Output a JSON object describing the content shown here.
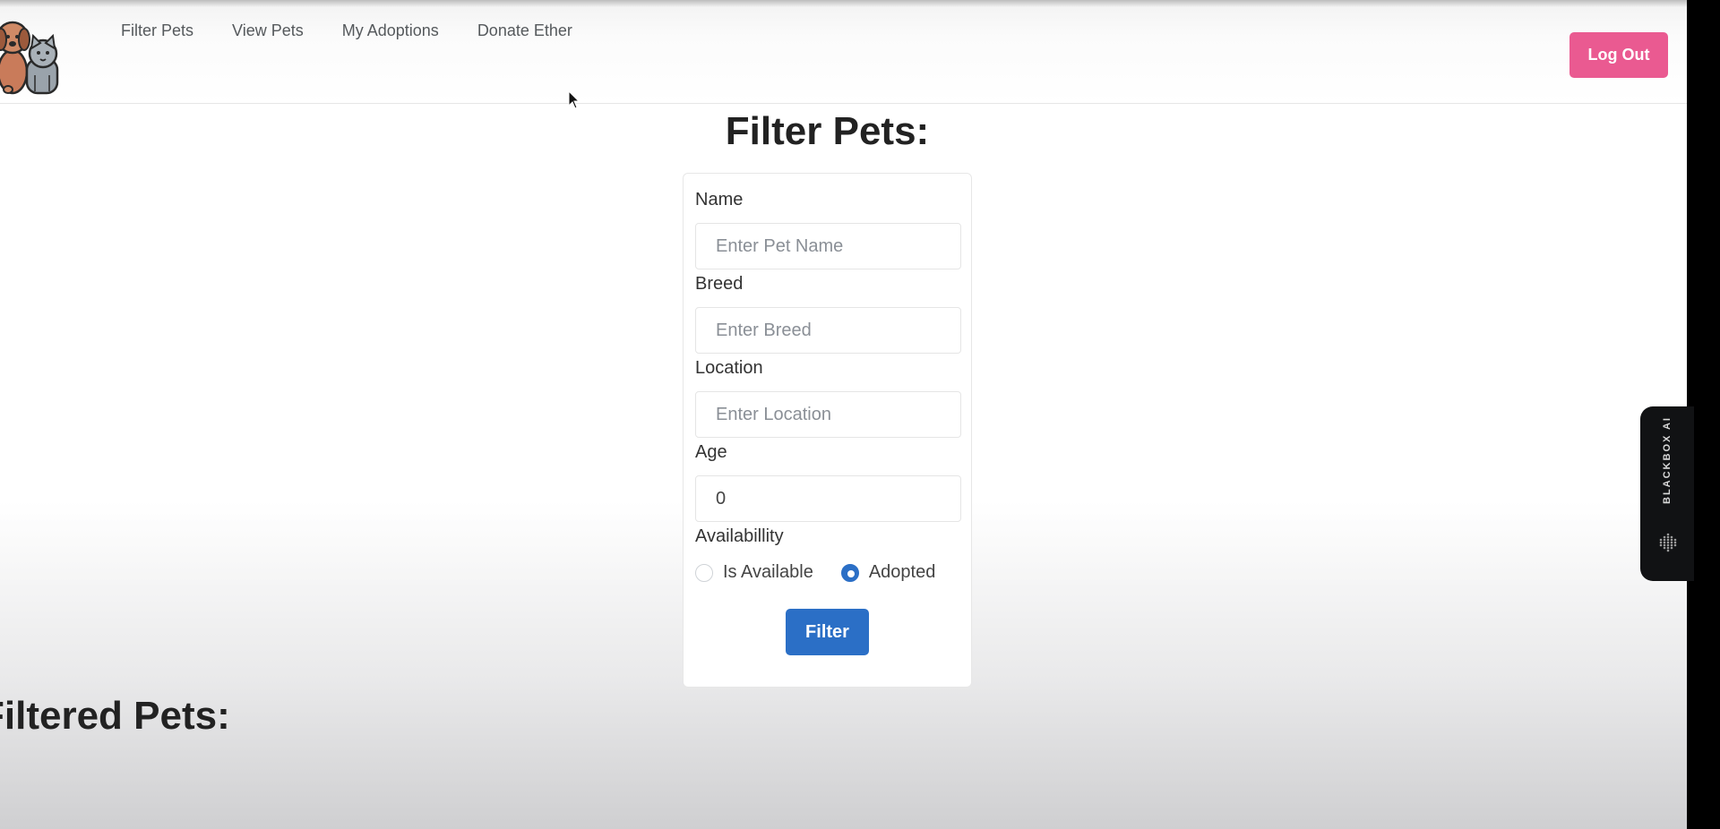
{
  "nav": {
    "links": [
      "Filter Pets",
      "View Pets",
      "My Adoptions",
      "Donate Ether"
    ],
    "logout_label": "Log Out"
  },
  "page": {
    "title": "Filter Pets:",
    "results_title": "Filtered Pets:"
  },
  "form": {
    "name_label": "Name",
    "name_placeholder": "Enter Pet Name",
    "breed_label": "Breed",
    "breed_placeholder": "Enter Breed",
    "location_label": "Location",
    "location_placeholder": "Enter Location",
    "age_label": "Age",
    "age_value": "0",
    "availability_label": "Availabillity",
    "options": [
      {
        "label": "Is Available",
        "selected": false
      },
      {
        "label": "Adopted",
        "selected": true
      }
    ],
    "filter_label": "Filter"
  },
  "side_widget": {
    "label": "BLACKBOX AI"
  },
  "colors": {
    "logout": "#ea5a91",
    "primary": "#2b6fc6"
  }
}
